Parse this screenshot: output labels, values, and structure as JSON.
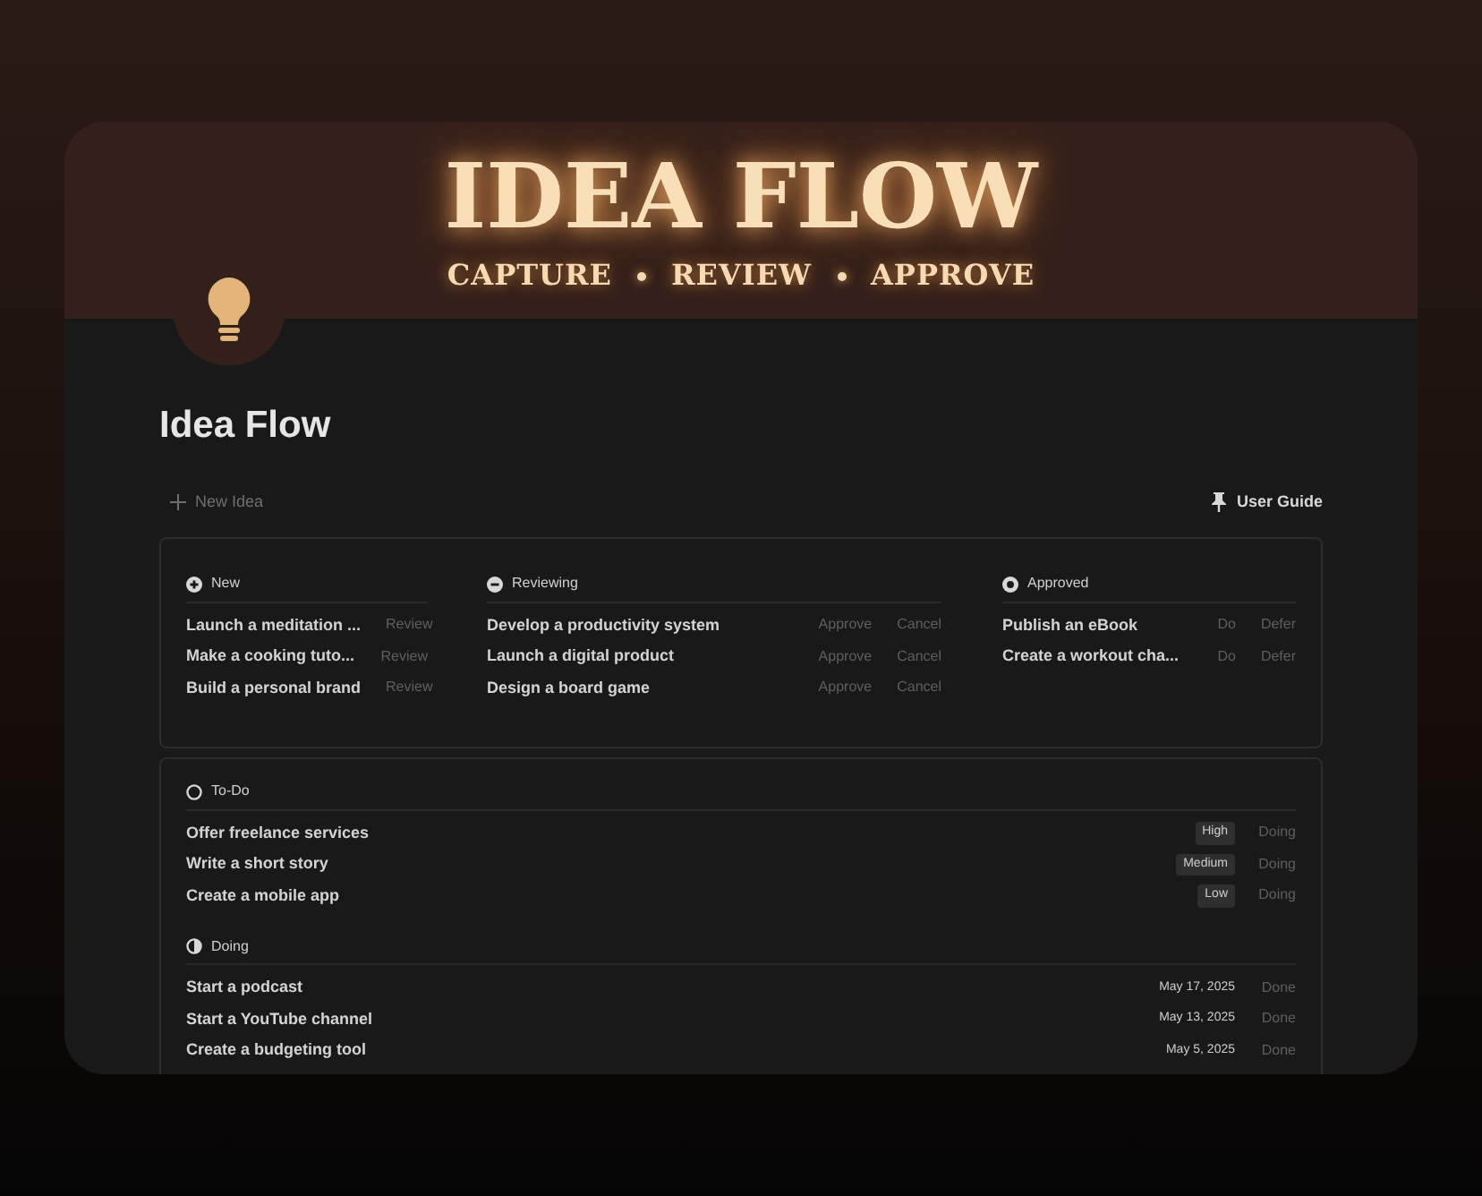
{
  "banner": {
    "title": "IDEA FLOW",
    "steps": [
      "CAPTURE",
      "REVIEW",
      "APPROVE"
    ]
  },
  "page": {
    "title": "Idea Flow"
  },
  "toolbar": {
    "new_button": "New Idea",
    "guide_link": "User Guide"
  },
  "board": [
    {
      "kind": "new",
      "title": "New",
      "items": [
        {
          "name": "Launch a meditation ...",
          "actions": [
            "Review"
          ]
        },
        {
          "name": "Make a cooking tuto...",
          "actions": [
            "Review"
          ]
        },
        {
          "name": "Build a personal brand",
          "actions": [
            "Review"
          ]
        }
      ]
    },
    {
      "kind": "reviewing",
      "title": "Reviewing",
      "items": [
        {
          "name": "Develop a productivity system",
          "actions": [
            "Approve",
            "Cancel"
          ]
        },
        {
          "name": "Launch a digital product",
          "actions": [
            "Approve",
            "Cancel"
          ]
        },
        {
          "name": "Design a board game",
          "actions": [
            "Approve",
            "Cancel"
          ]
        }
      ]
    },
    {
      "kind": "approved",
      "title": "Approved",
      "items": [
        {
          "name": "Publish an eBook",
          "actions": [
            "Do",
            "Defer"
          ]
        },
        {
          "name": "Create a workout cha...",
          "actions": [
            "Do",
            "Defer"
          ]
        }
      ]
    }
  ],
  "lists": [
    {
      "kind": "todo",
      "title": "To-Do",
      "rows": [
        {
          "name": "Offer freelance services",
          "tag": "High",
          "action": "Doing"
        },
        {
          "name": "Write a short story",
          "tag": "Medium",
          "action": "Doing"
        },
        {
          "name": "Create a mobile app",
          "tag": "Low",
          "action": "Doing"
        }
      ]
    },
    {
      "kind": "doing",
      "title": "Doing",
      "rows": [
        {
          "name": "Start a podcast",
          "date": "May 17, 2025",
          "action": "Done"
        },
        {
          "name": "Start a YouTube channel",
          "date": "May 13, 2025",
          "action": "Done"
        },
        {
          "name": "Create a budgeting tool",
          "date": "May 5, 2025",
          "action": "Done"
        }
      ]
    }
  ]
}
